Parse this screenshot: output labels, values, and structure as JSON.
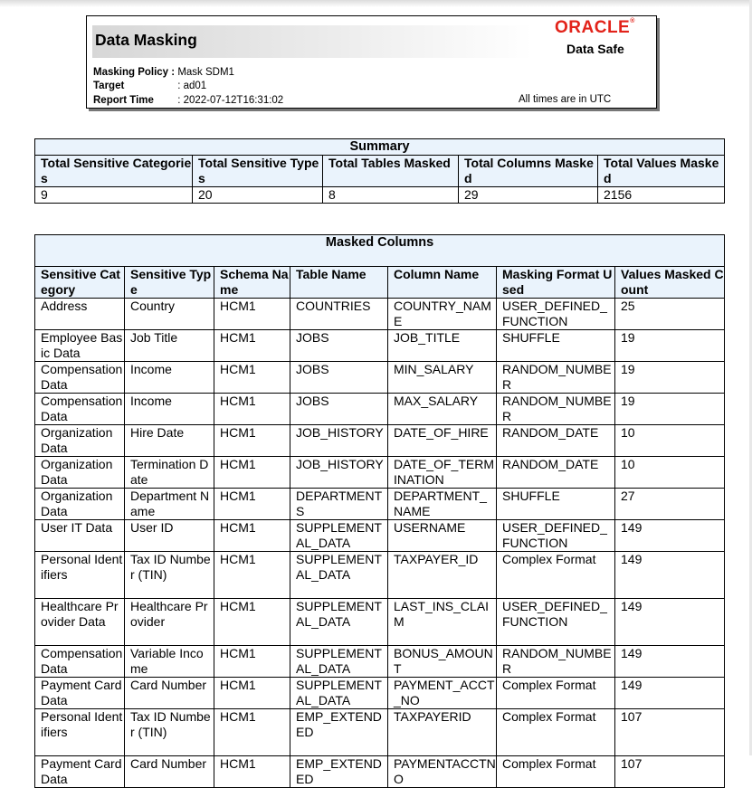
{
  "header": {
    "title": "Data Masking",
    "logo_text": "ORACLE",
    "product": "Data Safe",
    "policy_label": "Masking Policy :",
    "policy_value": "Mask SDM1",
    "target_label": "Target",
    "target_value": ": ad01",
    "report_time_label": "Report Time",
    "report_time_value": ": 2022-07-12T16:31:02",
    "timezone_note": "All times are in UTC"
  },
  "summary": {
    "caption": "Summary",
    "headers": [
      "Total Sensitive Categories",
      "Total Sensitive Types",
      "Total Tables Masked",
      "Total Columns Masked",
      "Total Values Masked"
    ],
    "values": [
      "9",
      "20",
      "8",
      "29",
      "2156"
    ]
  },
  "masked_columns": {
    "caption": "Masked Columns",
    "headers": [
      "Sensitive Category",
      "Sensitive Type",
      "Schema Name",
      "Table Name",
      "Column Name",
      "Masking Format Used",
      "Values Masked Count"
    ],
    "rows": [
      [
        "Address",
        "Country",
        "HCM1",
        "COUNTRIES",
        "COUNTRY_NAME",
        "USER_DEFINED_FUNCTION",
        "25"
      ],
      [
        "Employee Basic Data",
        "Job Title",
        "HCM1",
        "JOBS",
        "JOB_TITLE",
        "SHUFFLE",
        "19"
      ],
      [
        "Compensation Data",
        "Income",
        "HCM1",
        "JOBS",
        "MIN_SALARY",
        "RANDOM_NUMBER",
        "19"
      ],
      [
        "Compensation Data",
        "Income",
        "HCM1",
        "JOBS",
        "MAX_SALARY",
        "RANDOM_NUMBER",
        "19"
      ],
      [
        "Organization Data",
        "Hire Date",
        "HCM1",
        "JOB_HISTORY",
        "DATE_OF_HIRE",
        "RANDOM_DATE",
        "10"
      ],
      [
        "Organization Data",
        "Termination Date",
        "HCM1",
        "JOB_HISTORY",
        "DATE_OF_TERMINATION",
        "RANDOM_DATE",
        "10"
      ],
      [
        "Organization Data",
        "Department Name",
        "HCM1",
        "DEPARTMENTS",
        "DEPARTMENT_NAME",
        "SHUFFLE",
        "27"
      ],
      [
        "User IT Data",
        "User ID",
        "HCM1",
        "SUPPLEMENTAL_DATA",
        "USERNAME",
        "USER_DEFINED_FUNCTION",
        "149"
      ],
      [
        "Personal Identifiers",
        "Tax ID Number (TIN)",
        "HCM1",
        "SUPPLEMENTAL_DATA",
        "TAXPAYER_ID",
        "Complex Format",
        "149"
      ],
      [
        "Healthcare Provider Data",
        "Healthcare Provider",
        "HCM1",
        "SUPPLEMENTAL_DATA",
        "LAST_INS_CLAIM",
        "USER_DEFINED_FUNCTION",
        "149"
      ],
      [
        "Compensation Data",
        "Variable Income",
        "HCM1",
        "SUPPLEMENTAL_DATA",
        "BONUS_AMOUNT",
        "RANDOM_NUMBER",
        "149"
      ],
      [
        "Payment Card Data",
        "Card Number",
        "HCM1",
        "SUPPLEMENTAL_DATA",
        "PAYMENT_ACCT_NO",
        "Complex Format",
        "149"
      ],
      [
        "Personal Identifiers",
        "Tax ID Number (TIN)",
        "HCM1",
        "EMP_EXTENDED",
        "TAXPAYERID",
        "Complex Format",
        "107"
      ],
      [
        "Payment Card Data",
        "Card Number",
        "HCM1",
        "EMP_EXTENDED",
        "PAYMENTACCTNO",
        "Complex Format",
        "107"
      ]
    ]
  }
}
